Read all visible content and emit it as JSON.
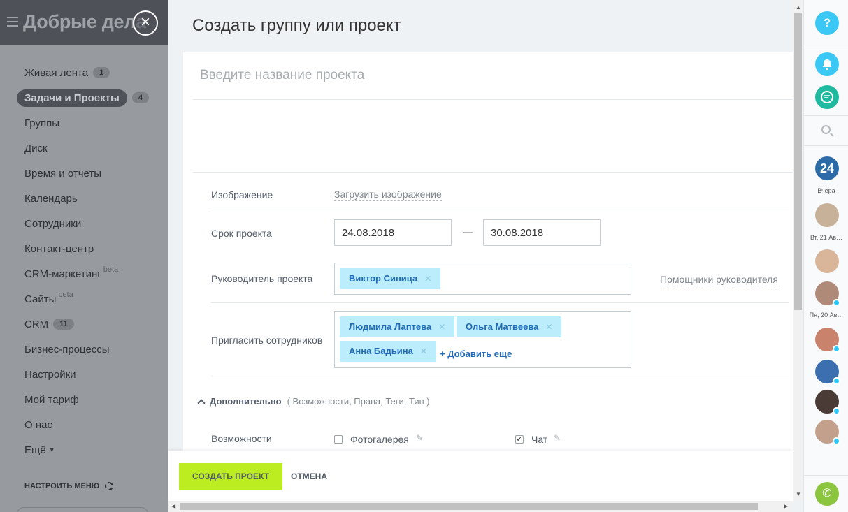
{
  "sidebar": {
    "brand": "Добрые дела",
    "items": [
      {
        "label": "Живая лента",
        "count": "1"
      },
      {
        "label": "Задачи и Проекты",
        "count": "4"
      },
      {
        "label": "Группы"
      },
      {
        "label": "Диск"
      },
      {
        "label": "Время и отчеты"
      },
      {
        "label": "Календарь"
      },
      {
        "label": "Сотрудники"
      },
      {
        "label": "Контакт-центр"
      },
      {
        "label": "CRM-маркетинг",
        "sup": "beta"
      },
      {
        "label": "Сайты",
        "sup": "beta"
      },
      {
        "label": "CRM",
        "count": "11"
      },
      {
        "label": "Бизнес-процессы"
      },
      {
        "label": "Настройки"
      },
      {
        "label": "Мой тариф"
      },
      {
        "label": "О нас"
      },
      {
        "label": "Ещё"
      }
    ],
    "setup_menu": "НАСТРОИТЬ МЕНЮ"
  },
  "panel": {
    "title": "Создать группу или проект",
    "name_placeholder": "Введите название проекта",
    "image_label": "Изображение",
    "upload_link": "Загрузить изображение",
    "deadline_label": "Срок проекта",
    "date_from": "24.08.2018",
    "date_to": "30.08.2018",
    "owner_label": "Руководитель проекта",
    "owner": "Виктор Синица",
    "assistants_link": "Помощники руководителя",
    "invite_label": "Пригласить сотрудников",
    "invitees": [
      "Людмила Лаптева",
      "Ольга Матвеева",
      "Анна Бадьина"
    ],
    "add_more": "+ Добавить еще",
    "extra_label": "Дополнительно",
    "extra_hint": "( Возможности,  Права,  Теги,  Тип  )",
    "features_label": "Возможности",
    "feature_gallery": "Фотогалерея",
    "feature_chat": "Чат",
    "create_button": "СОЗДАТЬ ПРОЕКТ",
    "cancel_button": "ОТМЕНА"
  },
  "right_panel": {
    "help": "?",
    "b24": "24",
    "day_yesterday": "Вчера",
    "day_tue": "Вт, 21 Ав…",
    "day_mon": "Пн, 20 Ав…"
  },
  "colors": {
    "accent_green": "#bbed21",
    "tag_bg": "#bcedfc",
    "link_blue": "#1f6ab5"
  }
}
